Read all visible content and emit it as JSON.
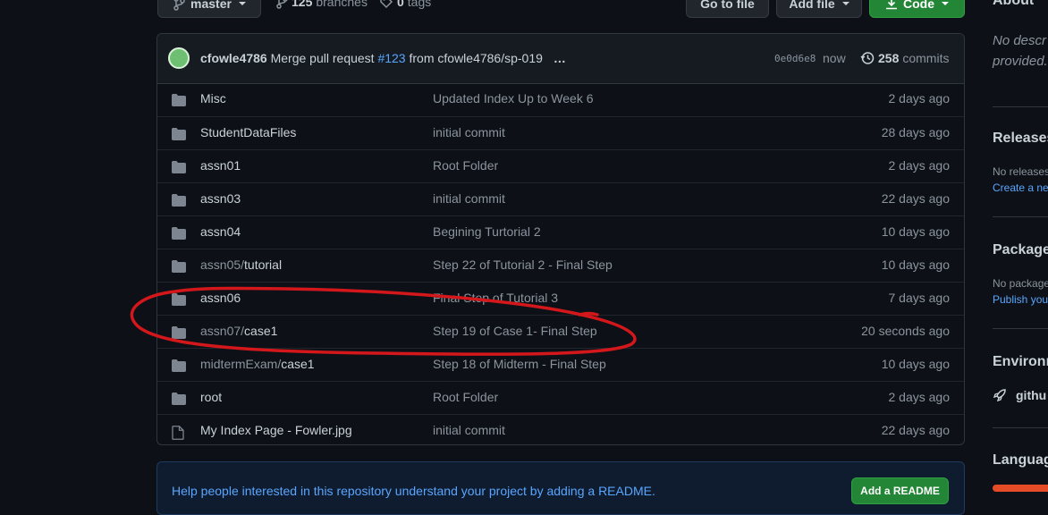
{
  "toolbar": {
    "branch_label": "master",
    "branches_count": "125",
    "branches_label": "branches",
    "tags_count": "0",
    "tags_label": "tags",
    "go_to_file": "Go to file",
    "add_file": "Add file",
    "code": "Code"
  },
  "commit": {
    "author": "cfowle4786",
    "message_prefix": "Merge pull request",
    "pr_link": "#123",
    "message_suffix": "from cfowle4786/sp-019",
    "ellipsis": "…",
    "sha": "0e0d6e8",
    "time": "now",
    "commits_count": "258",
    "commits_label": "commits"
  },
  "files": [
    {
      "type": "folder",
      "name_prefix": "",
      "name": "Misc",
      "message": "Updated Index Up to Week 6",
      "age": "2 days ago"
    },
    {
      "type": "folder",
      "name_prefix": "",
      "name": "StudentDataFiles",
      "message": "initial commit",
      "age": "28 days ago"
    },
    {
      "type": "folder",
      "name_prefix": "",
      "name": "assn01",
      "message": "Root Folder",
      "age": "2 days ago"
    },
    {
      "type": "folder",
      "name_prefix": "",
      "name": "assn03",
      "message": "initial commit",
      "age": "22 days ago"
    },
    {
      "type": "folder",
      "name_prefix": "",
      "name": "assn04",
      "message": "Begining Turtorial 2",
      "age": "10 days ago"
    },
    {
      "type": "folder",
      "name_prefix": "assn05/",
      "name": "tutorial",
      "message": "Step 22 of Tutorial 2 - Final Step",
      "age": "10 days ago"
    },
    {
      "type": "folder",
      "name_prefix": "",
      "name": "assn06",
      "message": "Final Step of Tutorial 3",
      "age": "7 days ago"
    },
    {
      "type": "folder",
      "name_prefix": "assn07/",
      "name": "case1",
      "message": "Step 19 of Case 1- Final Step",
      "age": "20 seconds ago"
    },
    {
      "type": "folder",
      "name_prefix": "midtermExam/",
      "name": "case1",
      "message": "Step 18 of Midterm - Final Step",
      "age": "10 days ago"
    },
    {
      "type": "folder",
      "name_prefix": "",
      "name": "root",
      "message": "Root Folder",
      "age": "2 days ago"
    },
    {
      "type": "file",
      "name_prefix": "",
      "name": "My Index Page - Fowler.jpg",
      "message": "initial commit",
      "age": "22 days ago"
    }
  ],
  "readme": {
    "text": "Help people interested in this repository understand your project by adding a README.",
    "button": "Add a README"
  },
  "sidebar": {
    "about_title": "About",
    "about_text_1": "No descr",
    "about_text_2": "provided.",
    "releases_title": "Releases",
    "releases_text": "No releases",
    "releases_link": "Create a new",
    "packages_title": "Packages",
    "packages_text": "No package",
    "packages_link": "Publish you",
    "environments_title": "Environm",
    "environment_item": "githu",
    "languages_title": "Language"
  },
  "colors": {
    "background": "#0d1117",
    "accent_green": "#238636",
    "link_blue": "#58a6ff",
    "annotation_red": "#d3171b"
  }
}
